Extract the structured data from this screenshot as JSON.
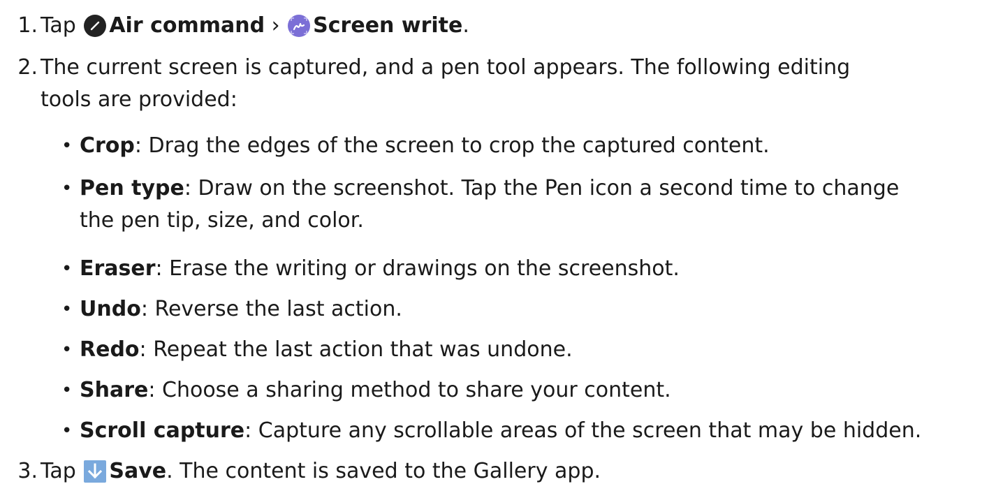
{
  "steps": [
    {
      "number": "1.",
      "prefix": "Tap",
      "air_command": "Air command",
      "separator": "›",
      "screen_write": "Screen write",
      "suffix": "."
    },
    {
      "number": "2.",
      "line1": "The current screen is captured, and a pen tool appears. The following editing",
      "line2": "tools are provided:"
    },
    {
      "number": "3.",
      "prefix": "Tap",
      "save": "Save",
      "suffix": ". The content is saved to the Gallery app."
    }
  ],
  "tools": [
    {
      "name": "Crop",
      "desc": ": Drag the edges of the screen to crop the captured content."
    },
    {
      "name": "Pen type",
      "desc": ": Draw on the screenshot. Tap the Pen icon a second time to change",
      "desc2": "the pen tip, size, and color."
    },
    {
      "name": "Eraser",
      "desc": ": Erase the writing or drawings on the screenshot."
    },
    {
      "name": "Undo",
      "desc": ": Reverse the last action."
    },
    {
      "name": "Redo",
      "desc": ": Repeat the last action that was undone."
    },
    {
      "name": "Share",
      "desc": ": Choose a sharing method to share your content."
    },
    {
      "name": "Scroll capture",
      "desc": ": Capture any scrollable areas of the screen that may be hidden."
    }
  ],
  "bullet_char": "•",
  "icons": {
    "air_command": "pen-circle-icon",
    "screen_write": "screen-write-icon",
    "save": "download-arrow-icon"
  },
  "colors": {
    "air_command_icon": "#222222",
    "screen_write_icon": "#7b6fd6",
    "save_icon": "#7aa9dd"
  }
}
